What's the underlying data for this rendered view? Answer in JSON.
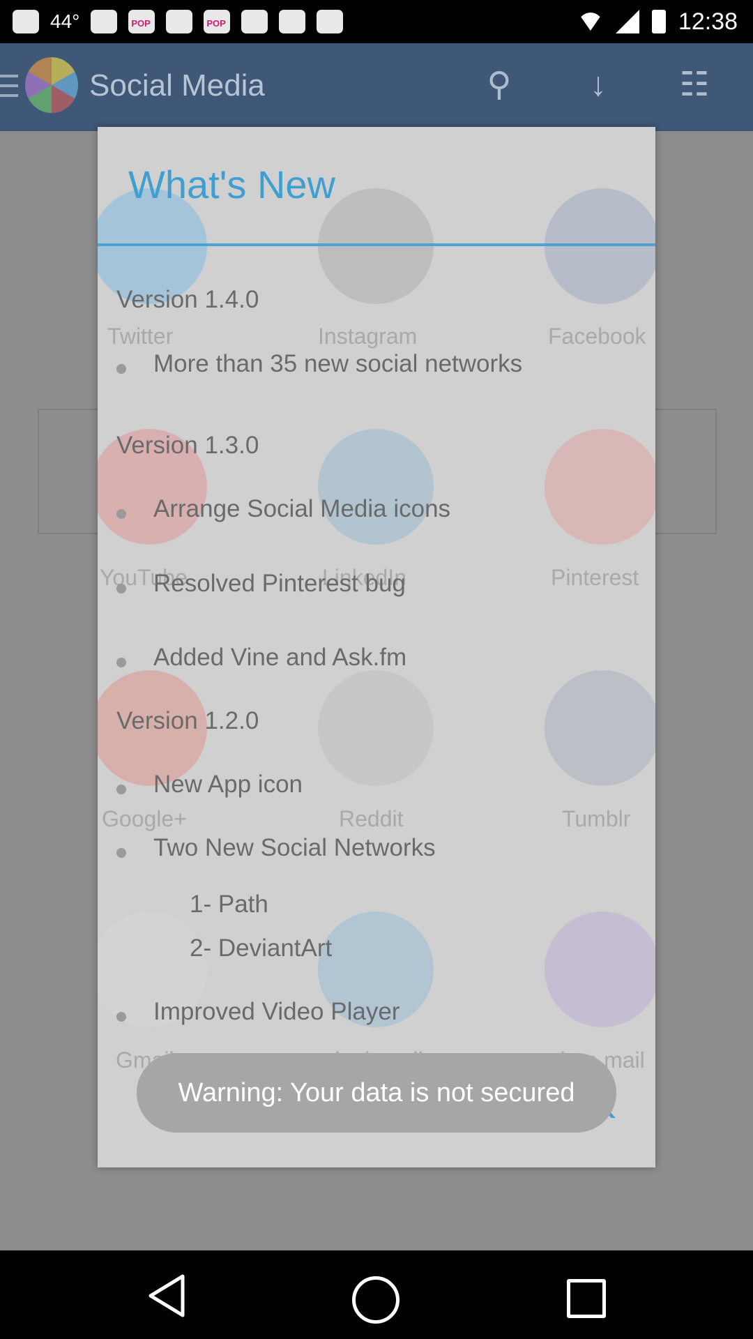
{
  "status_bar": {
    "temperature": "44°",
    "time": "12:38"
  },
  "app_bar": {
    "title": "Social Media"
  },
  "background_grid": {
    "labels": [
      "Twitter",
      "Instagram",
      "Facebook",
      "YouTube",
      "LinkedIn",
      "Pinterest",
      "Google+",
      "Reddit",
      "Tumblr",
      "Gmail",
      "outlook mail",
      "yahoo mail"
    ]
  },
  "dialog": {
    "title": "What's New",
    "ok_label": "OK",
    "sections": [
      {
        "version": "Version 1.4.0",
        "items": [
          "More than 35 new social networks"
        ]
      },
      {
        "version": "Version 1.3.0",
        "items": [
          "Arrange Social Media icons",
          "Resolved Pinterest bug",
          "Added Vine and Ask.fm"
        ]
      },
      {
        "version": "Version 1.2.0",
        "items": [
          "New App icon",
          "Two New Social Networks"
        ],
        "sub_items": [
          "1- Path",
          "2- DeviantArt"
        ],
        "items_after": [
          "Improved Video Player"
        ]
      }
    ]
  },
  "toast": {
    "message": "Warning: Your data is not secured"
  },
  "colors": {
    "accent": "#3f9fd0",
    "dialog_bg": "#d0d0d0",
    "toast_bg": "#a6a6a6"
  }
}
